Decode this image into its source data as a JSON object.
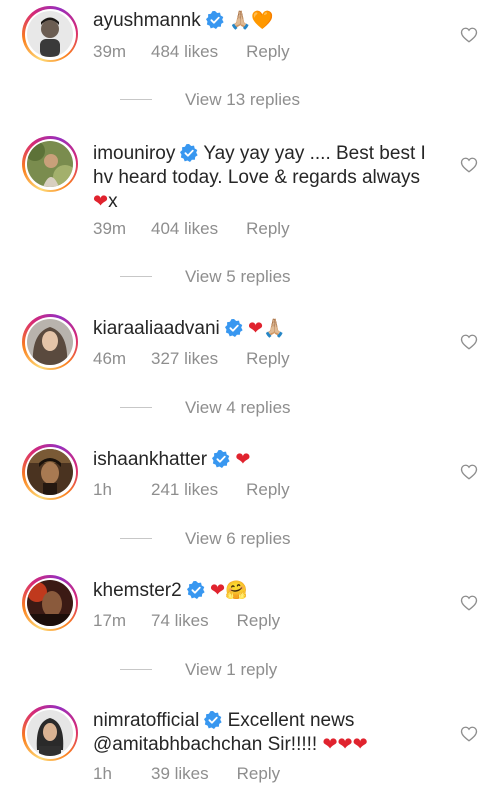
{
  "comments": [
    {
      "username": "ayushmannk",
      "text": "",
      "emojis": "🙏🏼🧡",
      "time": "39m",
      "likes": "484 likes",
      "reply": "Reply",
      "view_replies": "View 13 replies"
    },
    {
      "username": "imouniroy",
      "text_line1": "Yay yay yay .... Best best I",
      "text_line2": "hv heard today. Love & regards always",
      "text_line3_emoji": "❤",
      "text_line3_suffix": "x",
      "time": "39m",
      "likes": "404 likes",
      "reply": "Reply",
      "view_replies": "View 5 replies"
    },
    {
      "username": "kiaraaliaadvani",
      "emojis": "❤🙏🏼",
      "time": "46m",
      "likes": "327 likes",
      "reply": "Reply",
      "view_replies": "View 4 replies"
    },
    {
      "username": "ishaankhatter",
      "emojis": "❤",
      "time": "1h",
      "likes": "241 likes",
      "reply": "Reply",
      "view_replies": "View 6 replies"
    },
    {
      "username": "khemster2",
      "emojis": "❤🤗",
      "time": "17m",
      "likes": "74 likes",
      "reply": "Reply",
      "view_replies": "View 1 reply"
    },
    {
      "username": "nimratofficial",
      "text_line1": "Excellent news",
      "text_line2": "@amitabhbachchan Sir!!!!!",
      "text_line2_emojis": "❤❤❤",
      "time": "1h",
      "likes": "39 likes",
      "reply": "Reply"
    }
  ],
  "icons": {
    "verified": "verified-badge-icon",
    "like": "heart-outline-icon"
  },
  "colors": {
    "text": "#262626",
    "muted": "#8e8e8e",
    "verified": "#3897f0",
    "heart": "#e0232e"
  }
}
